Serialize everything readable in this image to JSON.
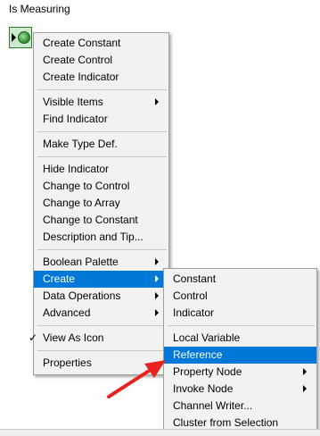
{
  "indicator": {
    "label": "Is Measuring"
  },
  "main_menu": {
    "groups": [
      [
        "Create Constant",
        "Create Control",
        "Create Indicator"
      ],
      [
        "Visible Items",
        "Find Indicator"
      ],
      [
        "Make Type Def."
      ],
      [
        "Hide Indicator",
        "Change to Control",
        "Change to Array",
        "Change to Constant",
        "Description and Tip..."
      ],
      [
        "Boolean Palette",
        "Create",
        "Data Operations",
        "Advanced"
      ],
      [
        "View As Icon"
      ],
      [
        "Properties"
      ]
    ],
    "check_mark": "✓"
  },
  "sub_menu": {
    "items": [
      "Constant",
      "Control",
      "Indicator",
      "Local Variable",
      "Reference",
      "Property Node",
      "Invoke Node",
      "Channel Writer...",
      "Cluster from Selection"
    ]
  },
  "colors": {
    "selection": "#0078d7",
    "arrow": "#e8221e"
  }
}
